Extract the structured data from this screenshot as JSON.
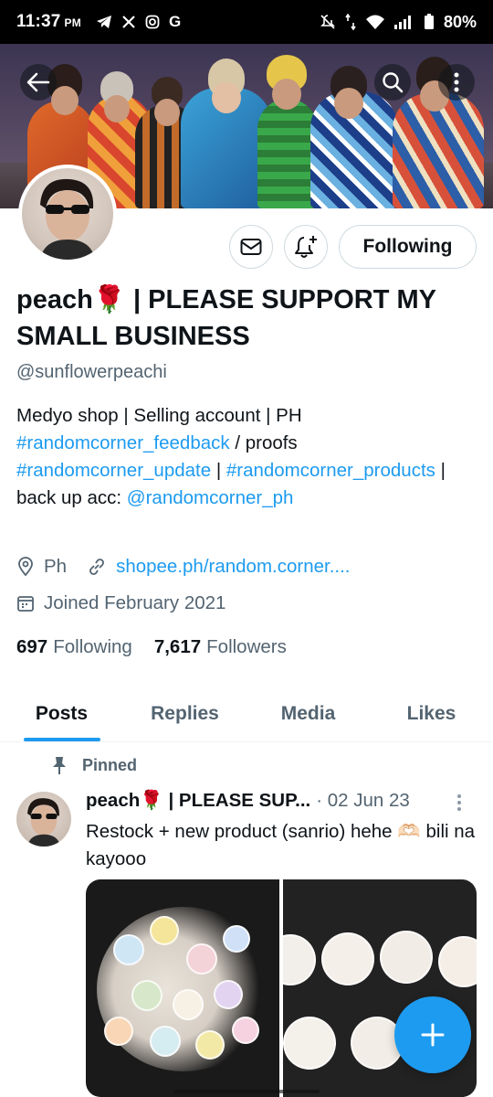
{
  "status_bar": {
    "time": "11:37",
    "ampm": "PM",
    "app_icons": [
      "telegram-icon",
      "x-icon",
      "instagram-icon",
      "google-icon"
    ],
    "battery": "80%"
  },
  "profile": {
    "display_name": "peach🌹 | PLEASE SUPPORT MY SMALL BUSINESS",
    "handle": "@sunflowerpeachi",
    "bio": {
      "part1": "Medyo shop | Selling account | PH ",
      "tag1": "#randomcorner_feedback",
      "part2": " / proofs ",
      "tag2": "#randomcorner_update",
      "part3": " | ",
      "tag3": "#randomcorner_products",
      "part4": " | back up acc: ",
      "mention": "@randomcorner_ph"
    },
    "location": "Ph",
    "website": "shopee.ph/random.corner....",
    "joined": "Joined February 2021",
    "following_count": "697",
    "following_label": "Following",
    "followers_count": "7,617",
    "followers_label": "Followers",
    "follow_button": "Following"
  },
  "tabs": [
    "Posts",
    "Replies",
    "Media",
    "Likes"
  ],
  "pinned_tweet": {
    "pinned_label": "Pinned",
    "author_name": "peach🌹 | PLEASE SUP...",
    "date": "· 02 Jun 23",
    "text": "Restock + new product (sanrio) hehe 🫶🏻 bili na kayooo"
  },
  "colors": {
    "accent": "#1d9bf0",
    "text_primary": "#0f1419",
    "text_secondary": "#536471"
  }
}
